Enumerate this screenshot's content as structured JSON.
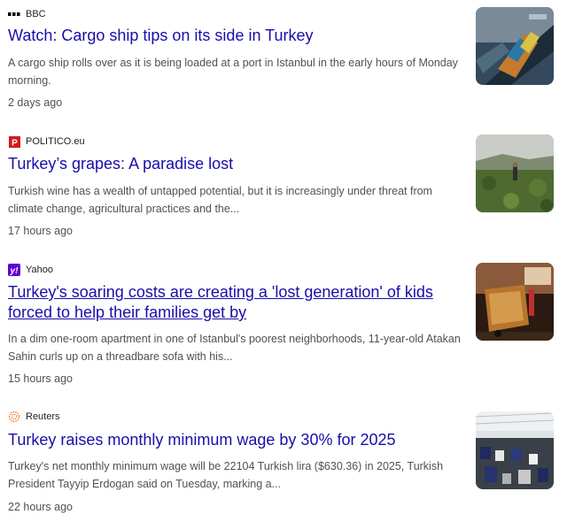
{
  "articles": [
    {
      "source": "BBC",
      "source_icon": "bbc-dots-icon",
      "headline": "Watch: Cargo ship tips on its side in Turkey",
      "snippet": "A cargo ship rolls over as it is being loaded at a port in Istanbul in the early hours of Monday morning.",
      "time": "2 days ago",
      "thumbnail": "cargo-ship-photo"
    },
    {
      "source": "POLITICO.eu",
      "source_icon": "politico-p-icon",
      "headline": "Turkey’s grapes: A paradise lost",
      "snippet": "Turkish wine has a wealth of untapped potential, but it is increasingly under threat from climate change, agricultural practices and the...",
      "time": "17 hours ago",
      "thumbnail": "vineyard-photo"
    },
    {
      "source": "Yahoo",
      "source_icon": "yahoo-y-icon",
      "headline": "Turkey's soaring costs are creating a 'lost generation' of kids forced to help their families get by",
      "snippet": "In a dim one-room apartment in one of Istanbul's poorest neighborhoods, 11-year-old Atakan Sahin curls up on a threadbare sofa with his...",
      "time": "15 hours ago",
      "thumbnail": "child-cart-photo"
    },
    {
      "source": "Reuters",
      "source_icon": "reuters-dots-icon",
      "headline": "Turkey raises monthly minimum wage by 30% for 2025",
      "snippet": "Turkey's net monthly minimum wage will be 22104 Turkish lira ($630.36) in 2025, Turkish President Tayyip Erdogan said on Tuesday, marking a...",
      "time": "22 hours ago",
      "thumbnail": "factory-workers-photo"
    }
  ],
  "colors": {
    "headline_link": "#1a0dab",
    "snippet_text": "#4d5156",
    "politico_red": "#d6181f",
    "yahoo_purple": "#6001d2",
    "reuters_orange": "#fa6400"
  }
}
